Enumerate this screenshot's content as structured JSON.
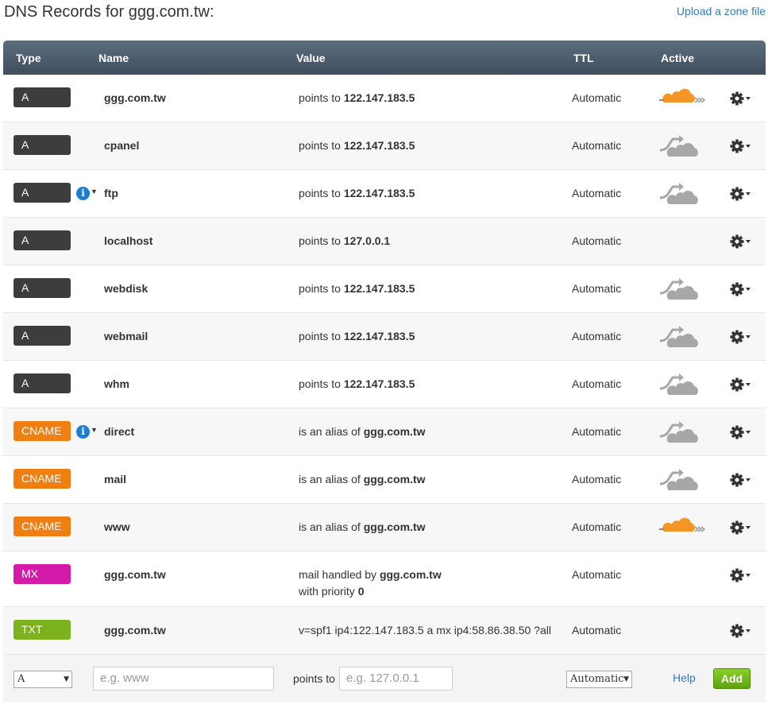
{
  "header": {
    "title": "DNS Records for ggg.com.tw:",
    "upload_link": "Upload a zone file"
  },
  "columns": {
    "type": "Type",
    "name": "Name",
    "value": "Value",
    "ttl": "TTL",
    "active": "Active"
  },
  "colors": {
    "A": "#3d3d3d",
    "CNAME": "#f07f12",
    "MX": "#d41aa8",
    "TXT": "#7bb21e",
    "cloud_active": "#f39626",
    "cloud_inactive": "#a7a7a7"
  },
  "records": [
    {
      "type": "A",
      "info": false,
      "name": "ggg.com.tw",
      "prefix": "points to ",
      "target": "122.147.183.5",
      "ttl": "Automatic",
      "cloud": "active"
    },
    {
      "type": "A",
      "info": false,
      "name": "cpanel",
      "prefix": "points to ",
      "target": "122.147.183.5",
      "ttl": "Automatic",
      "cloud": "inactive"
    },
    {
      "type": "A",
      "info": true,
      "name": "ftp",
      "prefix": "points to ",
      "target": "122.147.183.5",
      "ttl": "Automatic",
      "cloud": "inactive"
    },
    {
      "type": "A",
      "info": false,
      "name": "localhost",
      "prefix": "points to ",
      "target": "127.0.0.1",
      "ttl": "Automatic",
      "cloud": "none"
    },
    {
      "type": "A",
      "info": false,
      "name": "webdisk",
      "prefix": "points to ",
      "target": "122.147.183.5",
      "ttl": "Automatic",
      "cloud": "inactive"
    },
    {
      "type": "A",
      "info": false,
      "name": "webmail",
      "prefix": "points to ",
      "target": "122.147.183.5",
      "ttl": "Automatic",
      "cloud": "inactive"
    },
    {
      "type": "A",
      "info": false,
      "name": "whm",
      "prefix": "points to ",
      "target": "122.147.183.5",
      "ttl": "Automatic",
      "cloud": "inactive"
    },
    {
      "type": "CNAME",
      "info": true,
      "name": "direct",
      "prefix": "is an alias of ",
      "target": "ggg.com.tw",
      "ttl": "Automatic",
      "cloud": "inactive"
    },
    {
      "type": "CNAME",
      "info": false,
      "name": "mail",
      "prefix": "is an alias of ",
      "target": "ggg.com.tw",
      "ttl": "Automatic",
      "cloud": "inactive"
    },
    {
      "type": "CNAME",
      "info": false,
      "name": "www",
      "prefix": "is an alias of ",
      "target": "ggg.com.tw",
      "ttl": "Automatic",
      "cloud": "active"
    },
    {
      "type": "MX",
      "info": false,
      "name": "ggg.com.tw",
      "prefix": "mail handled by ",
      "target": "ggg.com.tw",
      "line2_prefix": "with priority ",
      "line2_value": "0",
      "ttl": "Automatic",
      "cloud": "none"
    },
    {
      "type": "TXT",
      "info": false,
      "name": "ggg.com.tw",
      "prefix": "v=spf1 ip4:122.147.183.5 a mx ip4:58.86.38.50 ?all",
      "target": "",
      "ttl": "Automatic",
      "cloud": "none"
    }
  ],
  "add_form": {
    "type_selected": "A",
    "name_placeholder": "e.g. www",
    "points_to_label": "points to",
    "value_placeholder": "e.g. 127.0.0.1",
    "ttl_selected": "Automatic",
    "help_label": "Help",
    "add_label": "Add"
  },
  "icons": {
    "info": "info-icon",
    "cloud": "cloudflare-cloud-icon",
    "gear": "gear-icon"
  }
}
